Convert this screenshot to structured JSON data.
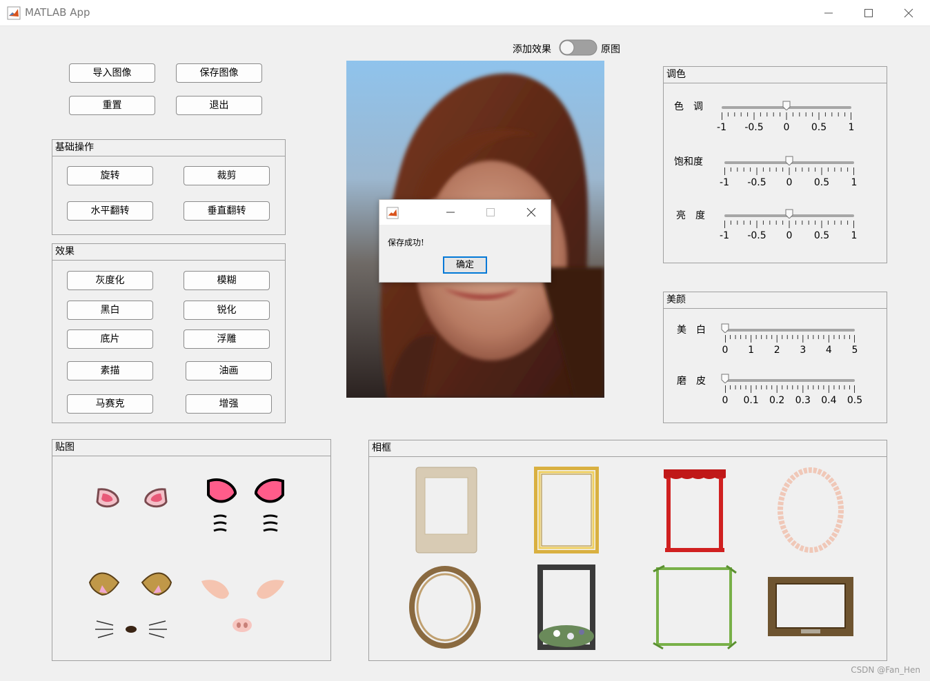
{
  "window": {
    "title": "MATLAB App"
  },
  "toolbar": {
    "import_label": "导入图像",
    "save_label": "保存图像",
    "reset_label": "重置",
    "exit_label": "退出"
  },
  "toggle": {
    "left_label": "添加效果",
    "right_label": "原图"
  },
  "basic": {
    "title": "基础操作",
    "rotate": "旋转",
    "crop": "裁剪",
    "hflip": "水平翻转",
    "vflip": "垂直翻转"
  },
  "effects": {
    "title": "效果",
    "gray": "灰度化",
    "blur": "模糊",
    "bw": "黑白",
    "sharpen": "锐化",
    "negative": "底片",
    "emboss": "浮雕",
    "sketch": "素描",
    "oil": "油画",
    "mosaic": "马赛克",
    "enhance": "增强"
  },
  "color": {
    "title": "调色",
    "hue": {
      "label": "色　调",
      "value": 0,
      "min": -1,
      "max": 1,
      "ticks": [
        "-1",
        "-0.5",
        "0",
        "0.5",
        "1"
      ]
    },
    "saturation": {
      "label": "饱和度",
      "value": 0,
      "min": -1,
      "max": 1,
      "ticks": [
        "-1",
        "-0.5",
        "0",
        "0.5",
        "1"
      ]
    },
    "brightness": {
      "label": "亮　度",
      "value": 0,
      "min": -1,
      "max": 1,
      "ticks": [
        "-1",
        "-0.5",
        "0",
        "0.5",
        "1"
      ]
    }
  },
  "beauty": {
    "title": "美颜",
    "whiten": {
      "label": "美　白",
      "value": 0,
      "min": 0,
      "max": 5,
      "ticks": [
        "0",
        "1",
        "2",
        "3",
        "4",
        "5"
      ]
    },
    "smooth": {
      "label": "磨　皮",
      "value": 0,
      "min": 0,
      "max": 0.5,
      "ticks": [
        "0",
        "0.1",
        "0.2",
        "0.3",
        "0.4",
        "0.5"
      ]
    }
  },
  "stickers": {
    "title": "贴图"
  },
  "frames": {
    "title": "相框"
  },
  "dialog": {
    "message": "保存成功!",
    "ok_label": "确定"
  },
  "watermark": "CSDN @Fan_Hen",
  "colors": {
    "accent": "#0078d7",
    "border": "#9f9f9f",
    "background": "#f0f0f0"
  }
}
